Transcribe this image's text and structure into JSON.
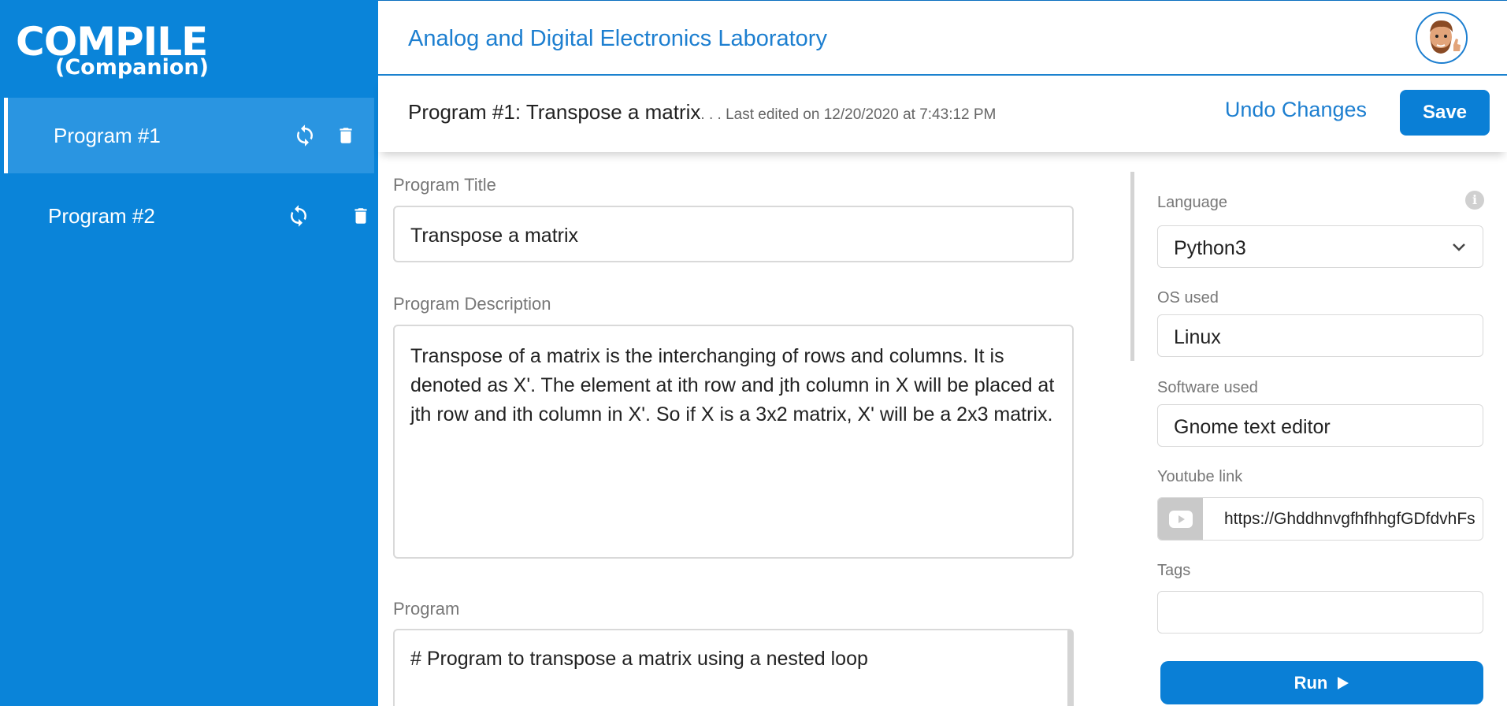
{
  "sidebar": {
    "logo_main": "COMPILE",
    "logo_sub": "(Companion)",
    "items": [
      {
        "label": "Program #1",
        "active": true
      },
      {
        "label": "Program #2",
        "active": false
      }
    ]
  },
  "header": {
    "lab_title": "Analog and Digital Electronics Laboratory"
  },
  "subheader": {
    "program_heading": "Program #1: Transpose a matrix",
    "last_edited": ". . . Last edited on 12/20/2020 at 7:43:12 PM",
    "undo_label": "Undo Changes",
    "save_label": "Save"
  },
  "form": {
    "title_label": "Program Title",
    "title_value": "Transpose a matrix",
    "description_label": "Program Description",
    "description_value": "Transpose of a matrix is the interchanging of rows and columns. It is denoted as X'. The element at ith row and jth column in X will be placed at jth row and ith column in X'. So if X is a 3x2 matrix, X' will be a 2x3 matrix.",
    "program_label": "Program",
    "program_value": "# Program to transpose a matrix using a nested loop"
  },
  "panel": {
    "language_label": "Language",
    "language_value": "Python3",
    "os_label": "OS used",
    "os_value": "Linux",
    "software_label": "Software used",
    "software_value": "Gnome text editor",
    "youtube_label": "Youtube link",
    "youtube_value": "https://GhddhnvgfhfhhgfGDfdvhFs",
    "tags_label": "Tags",
    "tags_value": "",
    "run_label": "Run"
  },
  "colors": {
    "primary": "#0a84d9",
    "accent_text": "#1d7fd0",
    "button": "#0a7fd6"
  }
}
